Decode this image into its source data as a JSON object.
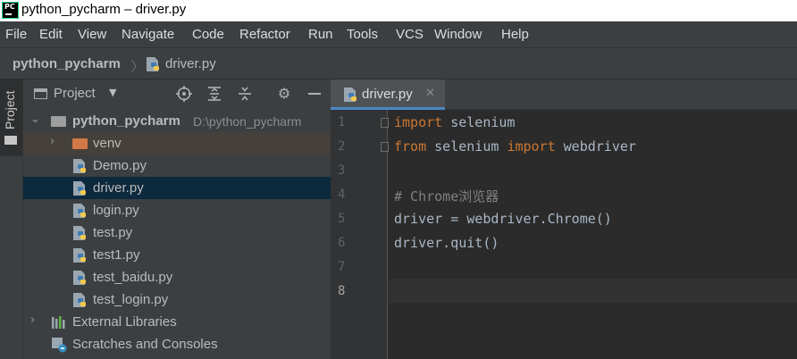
{
  "window": {
    "title": "python_pycharm – driver.py",
    "logo_text": "PC"
  },
  "menu": [
    "File",
    "Edit",
    "View",
    "Navigate",
    "Code",
    "Refactor",
    "Run",
    "Tools",
    "VCS",
    "Window",
    "Help"
  ],
  "breadcrumb": {
    "project": "python_pycharm",
    "file": "driver.py"
  },
  "toolstrip": {
    "tab_label": "Project"
  },
  "project_panel": {
    "title": "Project",
    "toolbar_icons": [
      "locate-icon",
      "expand-all-icon",
      "collapse-all-icon",
      "gear-icon",
      "hide-icon"
    ],
    "root": {
      "name": "python_pycharm",
      "path": "D:\\python_pycharm"
    },
    "venv": "venv",
    "files": [
      "Demo.py",
      "driver.py",
      "login.py",
      "test.py",
      "test1.py",
      "test_baidu.py",
      "test_login.py"
    ],
    "external_libraries": "External Libraries",
    "scratches": "Scratches and Consoles"
  },
  "editor": {
    "tab_label": "driver.py",
    "line_numbers": [
      "1",
      "2",
      "3",
      "4",
      "5",
      "6",
      "7",
      "8"
    ],
    "code": {
      "l1_kw": "import",
      "l1_rest": " selenium",
      "l2_kw1": "from",
      "l2_mid": " selenium ",
      "l2_kw2": "import",
      "l2_rest": " webdriver",
      "l4_comment": "# Chrome浏览器",
      "l5": "driver = webdriver.Chrome()",
      "l6": "driver.quit()"
    }
  },
  "colors": {
    "accent": "#4a88c7",
    "keyword": "#cc7832",
    "comment": "#808080",
    "selection": "#0d293e"
  }
}
